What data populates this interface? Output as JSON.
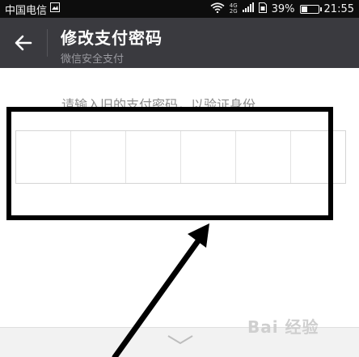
{
  "status_bar": {
    "carrier": "中国电信",
    "network_mini_top": "4G",
    "network_mini_bottom": "2G",
    "battery_percent": "39%",
    "battery_level": 0.39,
    "time": "21:55"
  },
  "header": {
    "title": "修改支付密码",
    "subtitle": "微信安全支付"
  },
  "main": {
    "prompt": "请输入旧的支付密码，以验证身份",
    "password_cells": 6
  },
  "watermark": "Bai 经验",
  "colors": {
    "status_bar_bg": "#0d0d0d",
    "title_bar_bg": "#3a3a3f",
    "annotation": "#000000"
  },
  "icons": [
    "back-arrow-icon",
    "wifi-icon",
    "signal-icon",
    "sim-icon",
    "battery-icon",
    "chevron-down-icon",
    "gallery-icon"
  ]
}
